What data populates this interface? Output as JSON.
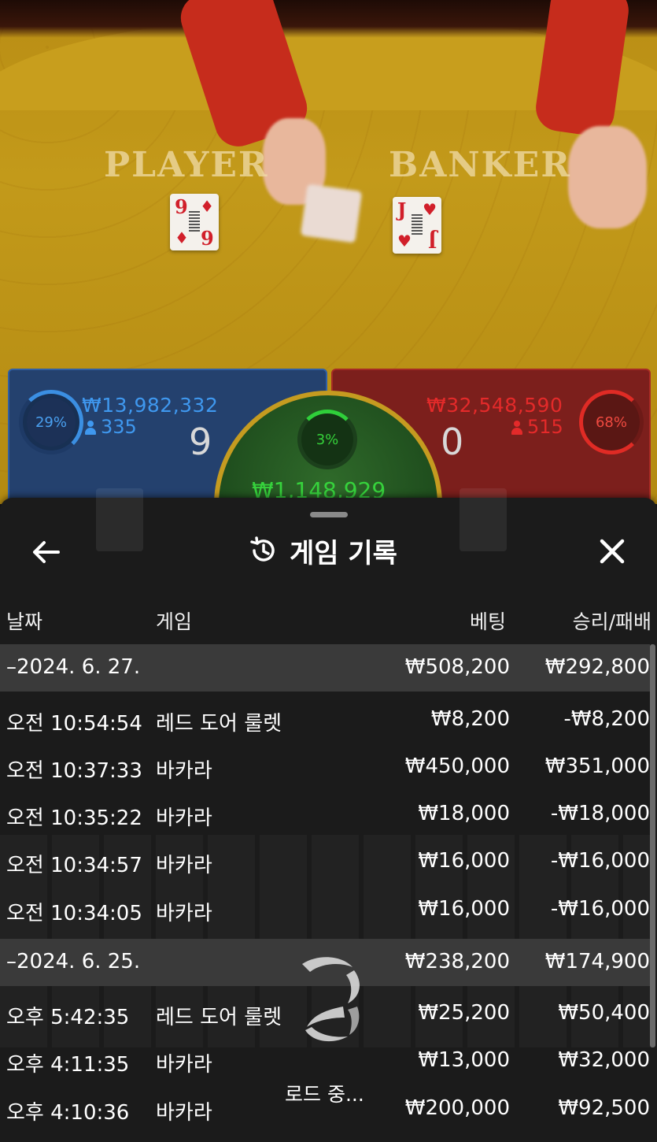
{
  "video": {
    "player_label": "PLAYER",
    "banker_label": "BANKER",
    "player_card": {
      "top": "9",
      "bottom": "6",
      "suit": "♦"
    },
    "banker_card": {
      "top": "J",
      "bottom": "J",
      "suit": "♥"
    }
  },
  "bets": {
    "player": {
      "percent": "29%",
      "amount": "₩13,982,332",
      "players": "335",
      "score": "9"
    },
    "banker": {
      "percent": "68%",
      "amount": "₩32,548,590",
      "players": "515",
      "score": "0"
    },
    "tie": {
      "percent": "3%",
      "amount": "₩1,148,929"
    }
  },
  "colors": {
    "player": "#3f98ef",
    "banker": "#e42a2a",
    "tie": "#36d23c",
    "sheet_bg": "#1b1b1b",
    "date_row_bg": "#3a3a3a"
  },
  "history": {
    "title": "게임 기록",
    "icons": {
      "back": "arrow-left-icon",
      "history": "history-icon",
      "close": "close-icon",
      "loading": "loading-spinner-icon"
    },
    "columns": {
      "date": "날짜",
      "game": "게임",
      "bet": "베팅",
      "result": "승리/패배"
    },
    "groups": [
      {
        "date": "–2024. 6. 27.",
        "total_bet": "₩508,200",
        "total_result": "₩292,800",
        "rows": [
          {
            "time": "오전 10:54:54",
            "game": "레드 도어 룰렛",
            "bet": "₩8,200",
            "result": "-₩8,200"
          },
          {
            "time": "오전 10:37:33",
            "game": "바카라",
            "bet": "₩450,000",
            "result": "₩351,000"
          },
          {
            "time": "오전 10:35:22",
            "game": "바카라",
            "bet": "₩18,000",
            "result": "-₩18,000"
          },
          {
            "time": "오전 10:34:57",
            "game": "바카라",
            "bet": "₩16,000",
            "result": "-₩16,000"
          },
          {
            "time": "오전 10:34:05",
            "game": "바카라",
            "bet": "₩16,000",
            "result": "-₩16,000"
          }
        ]
      },
      {
        "date": "–2024. 6. 25.",
        "total_bet": "₩238,200",
        "total_result": "₩174,900",
        "rows": [
          {
            "time": "오후 5:42:35",
            "game": "레드 도어 룰렛",
            "bet": "₩25,200",
            "result": "₩50,400"
          },
          {
            "time": "오후 4:11:35",
            "game": "바카라",
            "bet": "₩13,000",
            "result": "₩32,000"
          },
          {
            "time": "오후 4:10:36",
            "game": "바카라",
            "bet": "₩200,000",
            "result": "₩92,500"
          }
        ]
      }
    ],
    "loading_text": "로드 중..."
  }
}
